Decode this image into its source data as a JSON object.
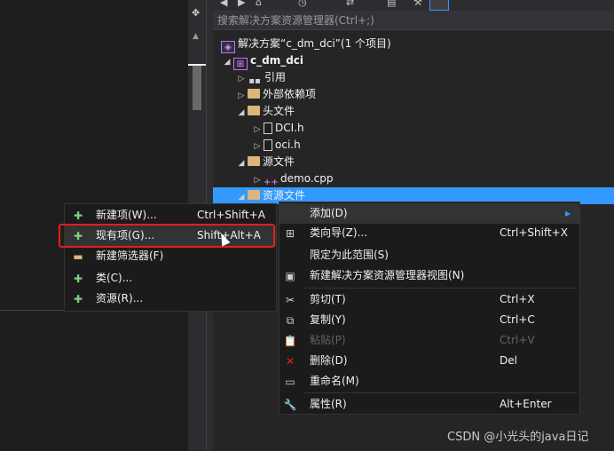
{
  "search": {
    "placeholder": "搜索解决方案资源管理器(Ctrl+;)"
  },
  "tree": {
    "solution": "解决方案“c_dm_dci”(1 个项目)",
    "project": "c_dm_dci",
    "references": "引用",
    "external_deps": "外部依赖项",
    "header_folder": "头文件",
    "header_files": [
      "DCI.h",
      "oci.h"
    ],
    "source_folder": "源文件",
    "source_files": [
      "demo.cpp"
    ],
    "resource_folder": "资源文件"
  },
  "context_menu": {
    "items": [
      {
        "label": "添加(D)",
        "shortcut": "",
        "icon": "none",
        "enabled": true
      },
      {
        "label": "类向导(Z)...",
        "shortcut": "Ctrl+Shift+X",
        "icon": "class-wizard-icon",
        "enabled": true
      },
      {
        "label": "限定为此范围(S)",
        "shortcut": "",
        "icon": "none",
        "enabled": true
      },
      {
        "label": "新建解决方案资源管理器视图(N)",
        "shortcut": "",
        "icon": "new-view-icon",
        "enabled": true
      },
      {
        "label": "剪切(T)",
        "shortcut": "Ctrl+X",
        "icon": "cut-icon",
        "enabled": true
      },
      {
        "label": "复制(Y)",
        "shortcut": "Ctrl+C",
        "icon": "copy-icon",
        "enabled": true
      },
      {
        "label": "粘贴(P)",
        "shortcut": "Ctrl+V",
        "icon": "paste-icon",
        "enabled": false
      },
      {
        "label": "删除(D)",
        "shortcut": "Del",
        "icon": "delete-icon",
        "enabled": true
      },
      {
        "label": "重命名(M)",
        "shortcut": "",
        "icon": "rename-icon",
        "enabled": true
      },
      {
        "label": "属性(R)",
        "shortcut": "Alt+Enter",
        "icon": "properties-icon",
        "enabled": true
      }
    ]
  },
  "submenu": {
    "items": [
      {
        "label": "新建项(W)...",
        "shortcut": "Ctrl+Shift+A",
        "icon": "new-item-icon"
      },
      {
        "label": "现有项(G)...",
        "shortcut": "Shift+Alt+A",
        "icon": "existing-item-icon"
      },
      {
        "label": "新建筛选器(F)",
        "shortcut": "",
        "icon": "new-filter-icon"
      },
      {
        "label": "类(C)...",
        "shortcut": "",
        "icon": "add-class-icon"
      },
      {
        "label": "资源(R)...",
        "shortcut": "",
        "icon": "add-resource-icon"
      }
    ]
  },
  "colors": {
    "accent": "#3399ff",
    "highlight_box": "#e51c1c",
    "folder": "#dcb67a",
    "project": "#b180d7"
  },
  "watermark": "CSDN @小光头的java日记"
}
